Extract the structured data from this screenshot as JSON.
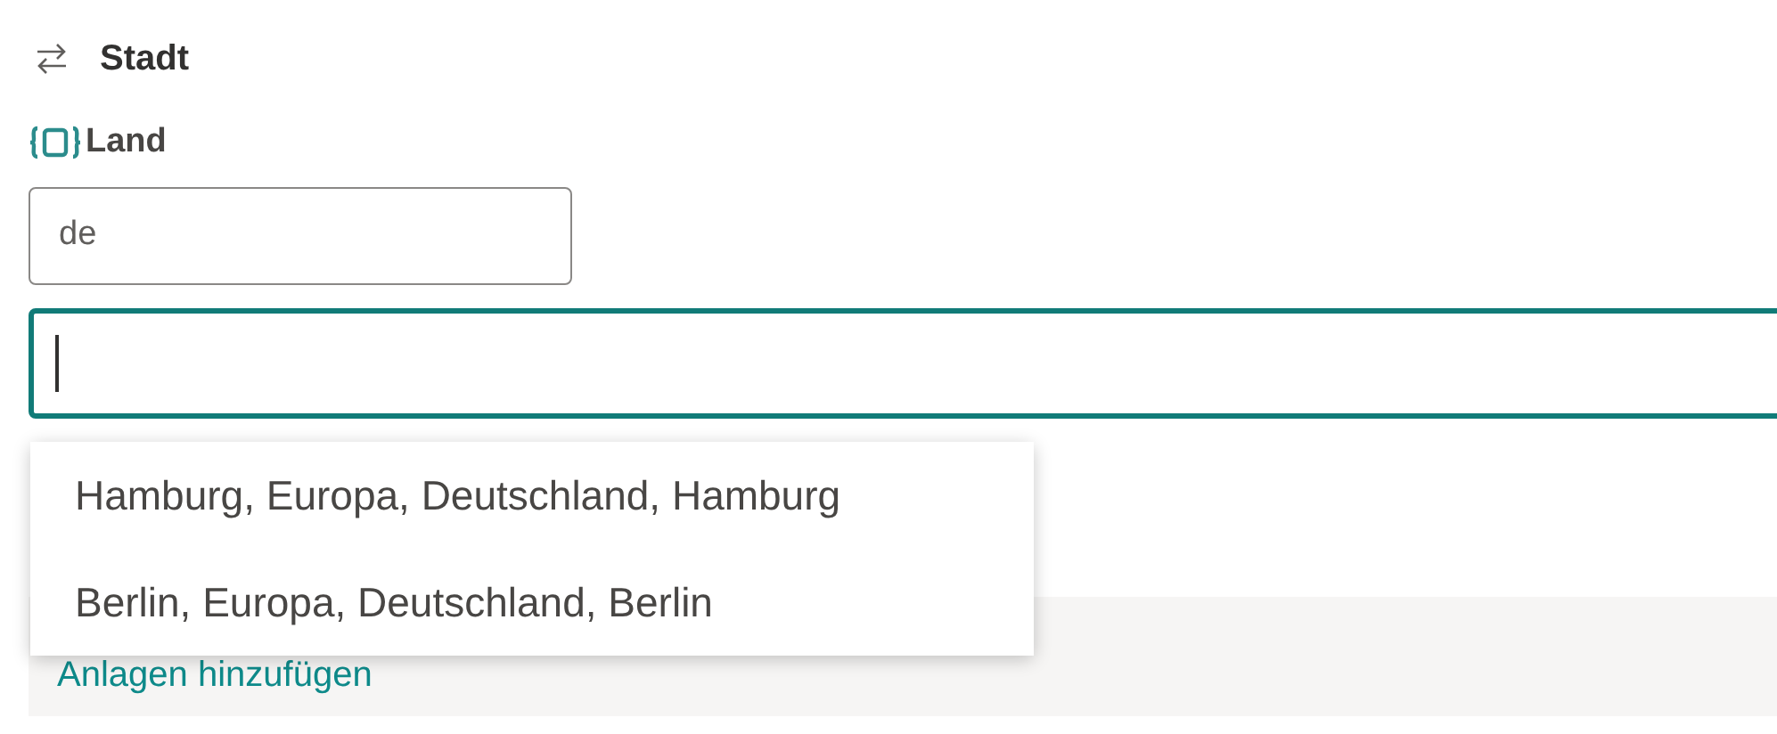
{
  "header": {
    "title": "Stadt"
  },
  "country_field": {
    "label": "Land",
    "value": "de"
  },
  "search_field": {
    "focused": true
  },
  "suggestions": [
    {
      "text": "Hamburg, Europa, Deutschland, Hamburg",
      "selected": false
    },
    {
      "text": "Berlin, Europa, Deutschland, Berlin",
      "selected": false
    }
  ],
  "attachments_link": "Anlagen hinzufügen"
}
